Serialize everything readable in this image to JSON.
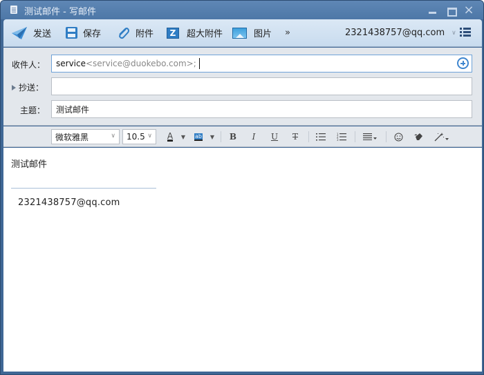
{
  "window": {
    "title": "测试邮件 - 写邮件"
  },
  "toolbar": {
    "send_label": "发送",
    "save_label": "保存",
    "attach_label": "附件",
    "big_attach_label": "超大附件",
    "big_attach_glyph": "Z",
    "picture_label": "图片",
    "more_label": "»",
    "account": "2321438757@qq.com"
  },
  "fields": {
    "to_label": "收件人：",
    "to_name": "service",
    "to_address": "<service@duokebo.com>;",
    "cc_label": "抄送：",
    "cc_value": "",
    "subject_label": "主题：",
    "subject_value": "测试邮件"
  },
  "format": {
    "font_family": "微软雅黑",
    "font_size": "10.5",
    "font_color_glyph": "A",
    "highlight_glyph": "ab",
    "bold": "B",
    "italic": "I",
    "underline": "U",
    "strike": "T"
  },
  "editor": {
    "body": "测试邮件",
    "signature": "2321438757@qq.com"
  },
  "colors": {
    "frame": "#3f6795",
    "accent": "#2f7dc4",
    "toolbar_bg": "#d5e4f3",
    "panel_bg": "#e3e7ec"
  }
}
